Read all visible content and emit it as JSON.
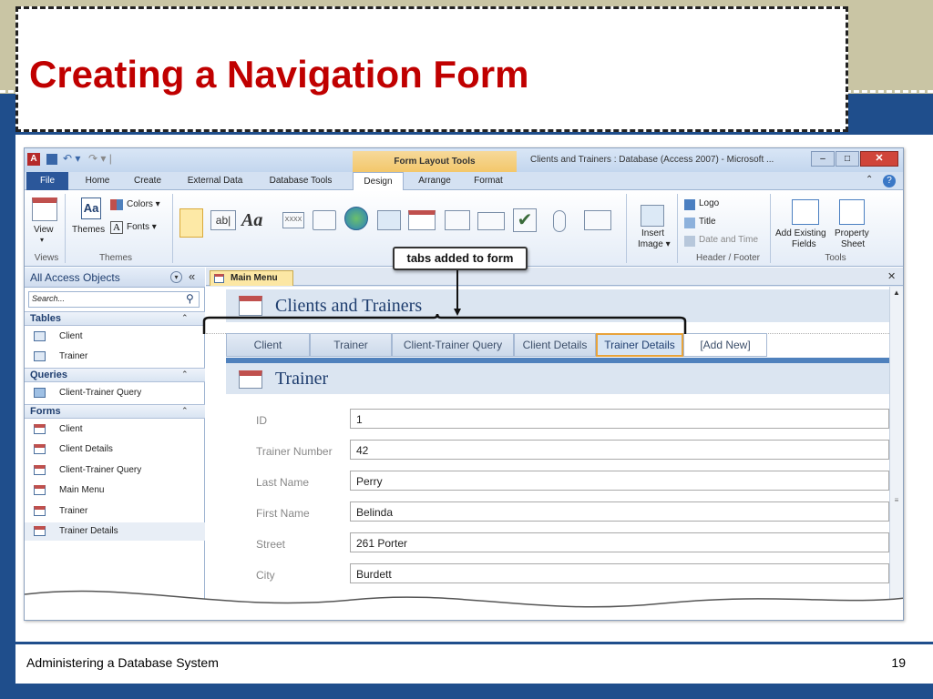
{
  "slide": {
    "title": "Creating a Navigation Form",
    "footer": "Administering a Database System",
    "page_number": "19"
  },
  "colors": {
    "title_red": "#c00000",
    "slide_blue": "#1f4e8c",
    "tan_band": "#c9c5a4",
    "tab_highlight": "#e8a33a"
  },
  "window": {
    "title": "Clients and Trainers : Database (Access 2007) - Microsoft ...",
    "context_tab": "Form Layout Tools",
    "app_icon": "A",
    "minimize": "–",
    "maximize": "□",
    "close": "✕"
  },
  "ribbon_tabs": [
    "File",
    "Home",
    "Create",
    "External Data",
    "Database Tools",
    "Design",
    "Arrange",
    "Format"
  ],
  "ribbon": {
    "view_label": "View",
    "themes_label": "Themes",
    "colors_label": "Colors ▾",
    "fonts_label": "Fonts ▾",
    "group_views": "Views",
    "group_themes": "Themes",
    "textbox_glyph": "ab|",
    "label_glyph": "Aa",
    "button_glyph": "XXXX",
    "check_glyph": "✔",
    "insert_image": "Insert",
    "insert_image_2": "Image ▾",
    "logo": "Logo",
    "title_btn": "Title",
    "date_time": "Date and Time",
    "group_header_footer": "Header / Footer",
    "add_existing_fields": "Add Existing",
    "add_existing_fields_2": "Fields",
    "property_sheet": "Property",
    "property_sheet_2": "Sheet",
    "group_tools": "Tools"
  },
  "callout": "tabs added to form",
  "nav_pane": {
    "title": "All Access Objects",
    "search_placeholder": "Search...",
    "groups": [
      {
        "name": "Tables",
        "items": [
          "Client",
          "Trainer"
        ]
      },
      {
        "name": "Queries",
        "items": [
          "Client-Trainer Query"
        ]
      },
      {
        "name": "Forms",
        "items": [
          "Client",
          "Client Details",
          "Client-Trainer Query",
          "Main Menu",
          "Trainer",
          "Trainer Details"
        ]
      }
    ]
  },
  "document": {
    "tab_label": "Main Menu",
    "form_title": "Clients and Trainers",
    "nav_tabs": [
      "Client",
      "Trainer",
      "Client-Trainer Query",
      "Client Details",
      "Trainer Details",
      "[Add New]"
    ],
    "active_tab": "Trainer Details",
    "subform_title": "Trainer",
    "fields": [
      {
        "label": "ID",
        "value": "1"
      },
      {
        "label": "Trainer Number",
        "value": "42"
      },
      {
        "label": "Last Name",
        "value": "Perry"
      },
      {
        "label": "First Name",
        "value": "Belinda"
      },
      {
        "label": "Street",
        "value": "261 Porter"
      },
      {
        "label": "City",
        "value": "Burdett"
      }
    ]
  }
}
